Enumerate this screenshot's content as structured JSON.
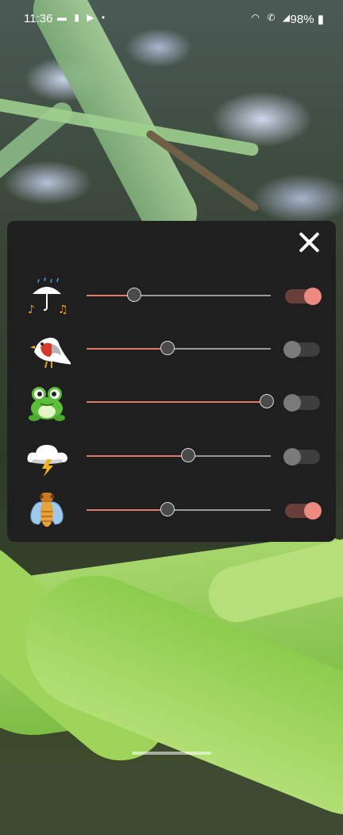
{
  "status_bar": {
    "time": "11:36",
    "battery": "98%",
    "left_icons": [
      "message-icon",
      "signal-bars-icon",
      "media-icon",
      "dot-icon"
    ],
    "right_icons": [
      "wifi-calling-icon",
      "call-icon",
      "cell-signal-icon"
    ]
  },
  "panel": {
    "close_icon": "close-icon",
    "rows": [
      {
        "icon": "rain-umbrella-icon",
        "volume": 0.26,
        "enabled": true
      },
      {
        "icon": "bird-icon",
        "volume": 0.44,
        "enabled": false
      },
      {
        "icon": "frog-icon",
        "volume": 0.98,
        "enabled": false
      },
      {
        "icon": "thunderstorm-icon",
        "volume": 0.55,
        "enabled": false
      },
      {
        "icon": "cicada-icon",
        "volume": 0.44,
        "enabled": true
      }
    ]
  },
  "colors": {
    "panel_bg": "#1f1f1f",
    "accent": "#e07a6c",
    "toggle_on_knob": "#ea8a80",
    "toggle_on_track": "#6a3e3a"
  }
}
